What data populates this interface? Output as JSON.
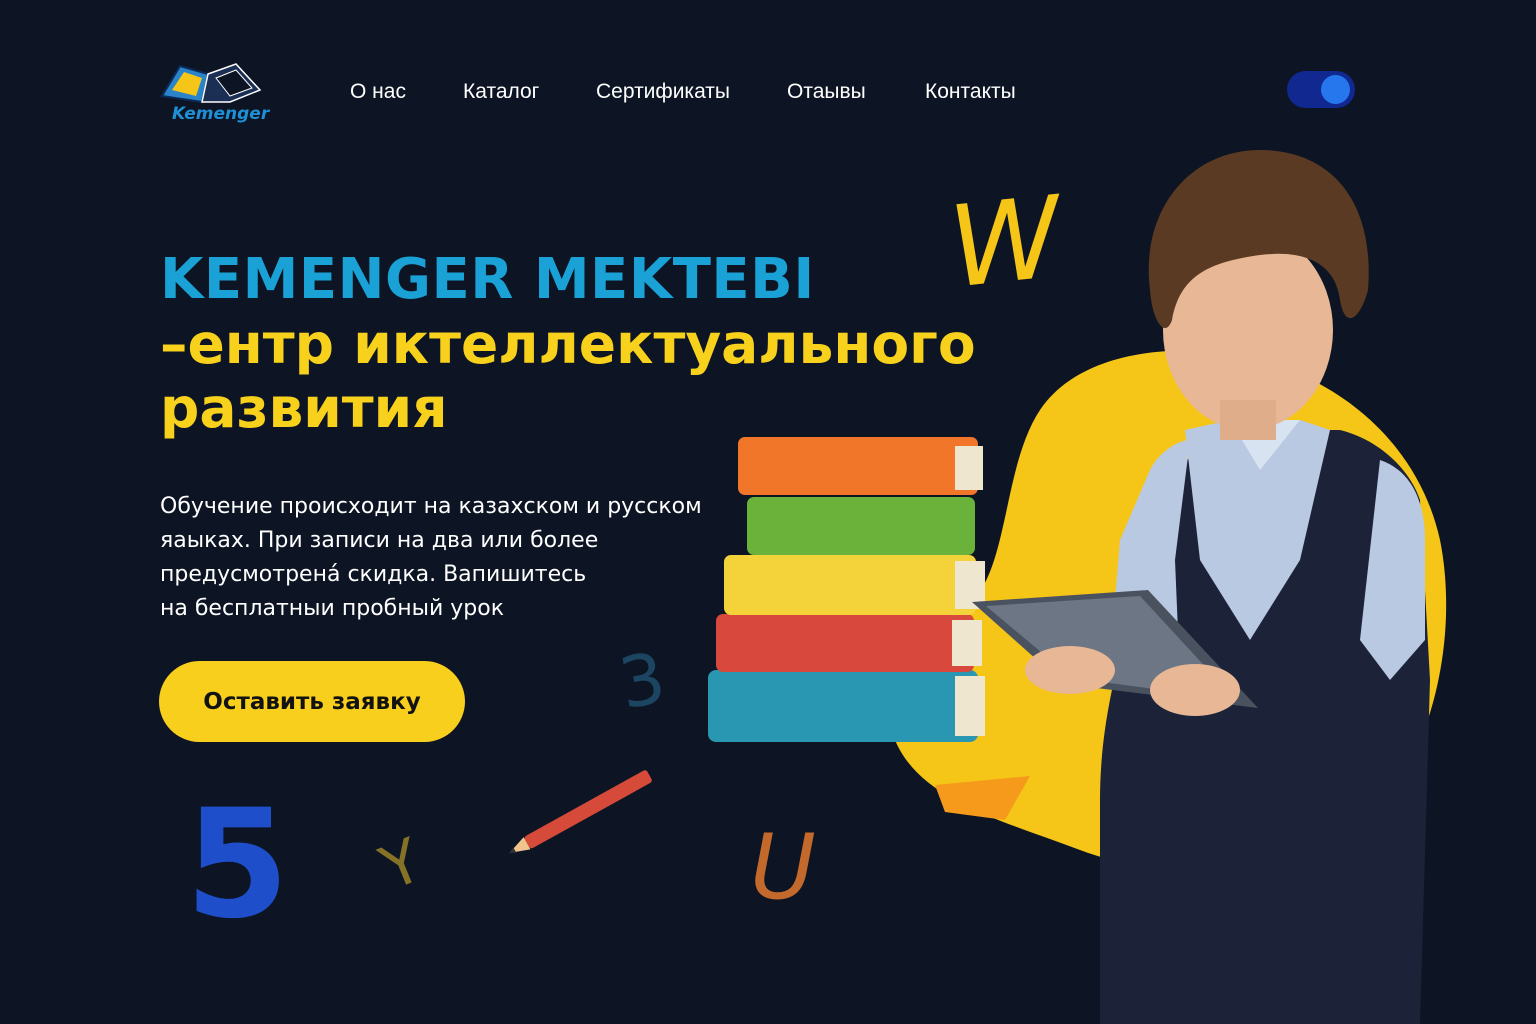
{
  "brand": {
    "name": "Kemenger"
  },
  "nav": {
    "items": [
      {
        "label": "О нас"
      },
      {
        "label": "Каталог"
      },
      {
        "label": "Сертификаты"
      },
      {
        "label": "Отаывы"
      },
      {
        "label": "Контакты"
      }
    ]
  },
  "theme_toggle": {
    "state": "on",
    "color": "#10288f",
    "knob_color": "#2677ee"
  },
  "hero": {
    "title_line1": "KEMENGER MEKTEBI",
    "title_line2": "–ентр иктеллектуального",
    "title_line3": "развития",
    "description_lines": [
      "Обучение происходит на казахском и русском",
      "яаыках. При записи на два или более",
      "предусмотренá скидка. Вапишитесь",
      "на бесплатныи пробный урок"
    ],
    "cta_label": "Оставить заявку"
  },
  "decor_letters": [
    "W",
    "5",
    "Y",
    "U",
    "3"
  ],
  "colors": {
    "background": "#0d1524",
    "accent_blue": "#1aa2d6",
    "accent_yellow": "#f7d11b",
    "button": "#f8cf1c"
  }
}
